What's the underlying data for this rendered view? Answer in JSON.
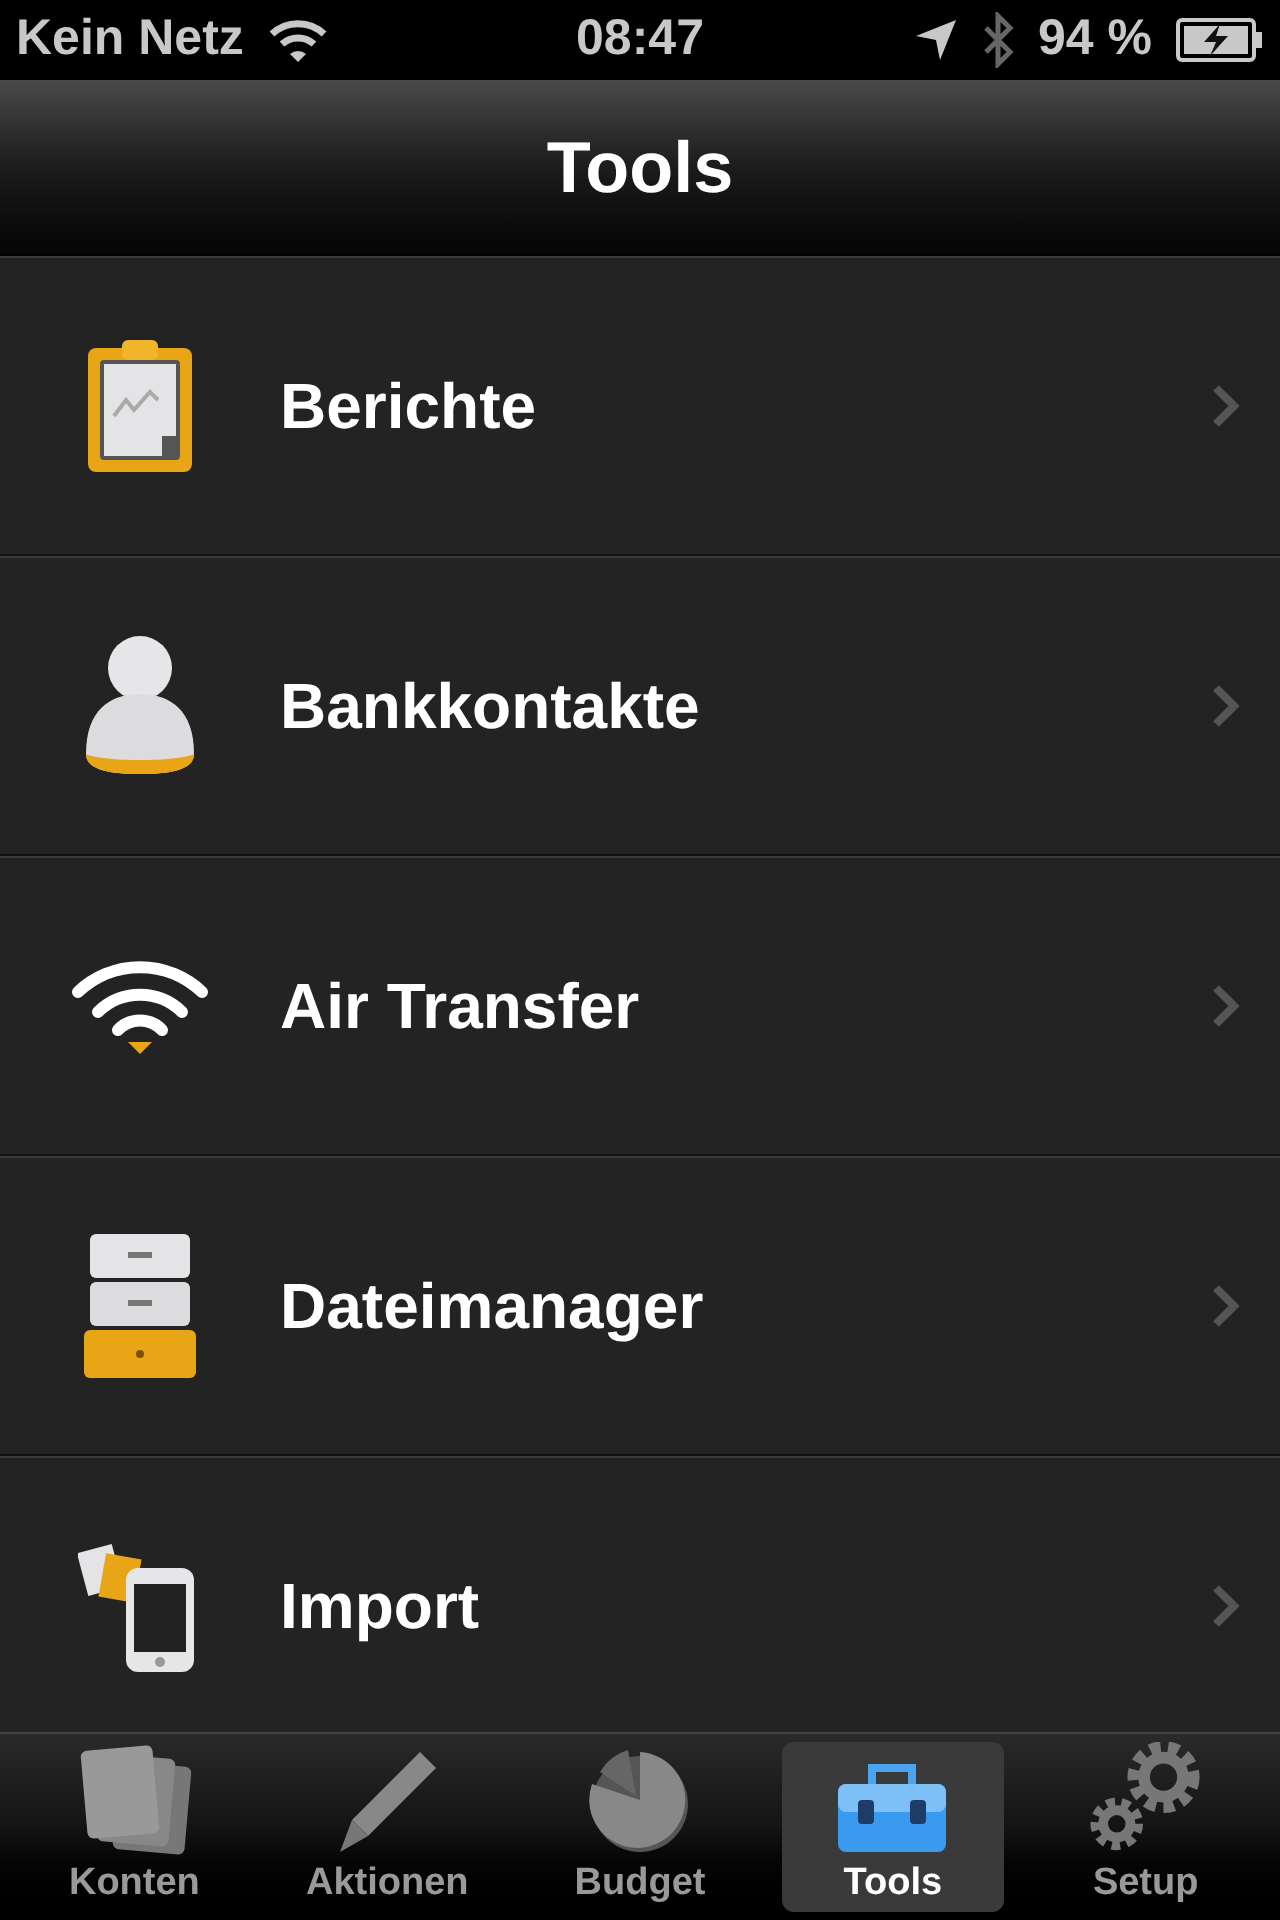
{
  "status_bar": {
    "carrier": "Kein Netz",
    "time": "08:47",
    "battery": "94 %"
  },
  "nav_bar": {
    "title": "Tools"
  },
  "items": [
    {
      "label": "Berichte"
    },
    {
      "label": "Bankkontakte"
    },
    {
      "label": "Air Transfer"
    },
    {
      "label": "Dateimanager"
    },
    {
      "label": "Import"
    }
  ],
  "tabs": [
    {
      "label": "Konten",
      "selected": false
    },
    {
      "label": "Aktionen",
      "selected": false
    },
    {
      "label": "Budget",
      "selected": false
    },
    {
      "label": "Tools",
      "selected": true
    },
    {
      "label": "Setup",
      "selected": false
    }
  ]
}
